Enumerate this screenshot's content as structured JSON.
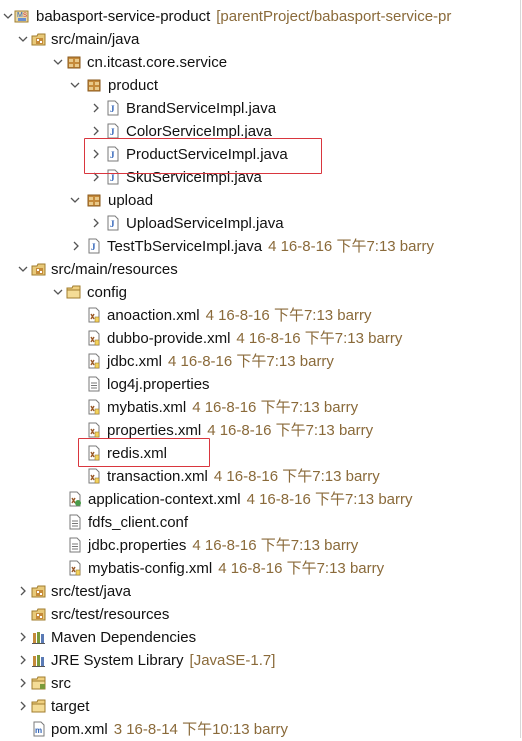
{
  "tree": {
    "cut_top_text": "[parentProject/babasport-service-pr",
    "items": [
      {
        "id": "proj",
        "label": "babasport-service-product",
        "deco": "[parentProject/babasport-service-pr"
      },
      {
        "id": "srcmainjava",
        "label": "src/main/java"
      },
      {
        "id": "pkg-service",
        "label": "cn.itcast.core.service"
      },
      {
        "id": "pkg-product",
        "label": "product"
      },
      {
        "id": "brand",
        "label": "BrandServiceImpl.java"
      },
      {
        "id": "color",
        "label": "ColorServiceImpl.java"
      },
      {
        "id": "productsvc",
        "label": "ProductServiceImpl.java"
      },
      {
        "id": "sku",
        "label": "SkuServiceImpl.java"
      },
      {
        "id": "pkg-upload",
        "label": "upload"
      },
      {
        "id": "uploadsvc",
        "label": "UploadServiceImpl.java"
      },
      {
        "id": "testtb",
        "label": "TestTbServiceImpl.java",
        "deco": "4  16-8-16 下午7:13  barry"
      },
      {
        "id": "srcmainres",
        "label": "src/main/resources"
      },
      {
        "id": "config",
        "label": "config"
      },
      {
        "id": "anoaction",
        "label": "anoaction.xml",
        "deco": "4  16-8-16 下午7:13  barry"
      },
      {
        "id": "dubbo",
        "label": "dubbo-provide.xml",
        "deco": "4  16-8-16 下午7:13  barry"
      },
      {
        "id": "jdbcxml",
        "label": "jdbc.xml",
        "deco": "4  16-8-16 下午7:13  barry"
      },
      {
        "id": "log4j",
        "label": "log4j.properties"
      },
      {
        "id": "mybatis",
        "label": "mybatis.xml",
        "deco": "4  16-8-16 下午7:13  barry"
      },
      {
        "id": "properties",
        "label": "properties.xml",
        "deco": "4  16-8-16 下午7:13  barry"
      },
      {
        "id": "redis",
        "label": "redis.xml"
      },
      {
        "id": "transaction",
        "label": "transaction.xml",
        "deco": "4  16-8-16 下午7:13  barry"
      },
      {
        "id": "appctx",
        "label": "application-context.xml",
        "deco": "4  16-8-16 下午7:13  barry"
      },
      {
        "id": "fdfs",
        "label": "fdfs_client.conf"
      },
      {
        "id": "jdbcprops",
        "label": "jdbc.properties",
        "deco": "4  16-8-16 下午7:13  barry"
      },
      {
        "id": "mybatiscfg",
        "label": "mybatis-config.xml",
        "deco": "4  16-8-16 下午7:13  barry"
      },
      {
        "id": "srctestjava",
        "label": "src/test/java"
      },
      {
        "id": "srctestres",
        "label": "src/test/resources"
      },
      {
        "id": "maven",
        "label": "Maven Dependencies"
      },
      {
        "id": "jre",
        "label": "JRE System Library",
        "deco": "[JavaSE-1.7]"
      },
      {
        "id": "src",
        "label": "src"
      },
      {
        "id": "target",
        "label": "target"
      },
      {
        "id": "pom",
        "label": "pom.xml",
        "deco": "3  16-8-14 下午10:13  barry"
      }
    ]
  },
  "highlight_color": "#d9363e",
  "decoration_color": "#8a6a3a",
  "icons": [
    "project-icon",
    "source-folder-icon",
    "package-icon",
    "java-file-icon",
    "folder-icon",
    "xml-file-icon",
    "properties-file-icon",
    "library-icon",
    "jre-library-icon",
    "chevron-down-icon",
    "chevron-right-icon"
  ]
}
